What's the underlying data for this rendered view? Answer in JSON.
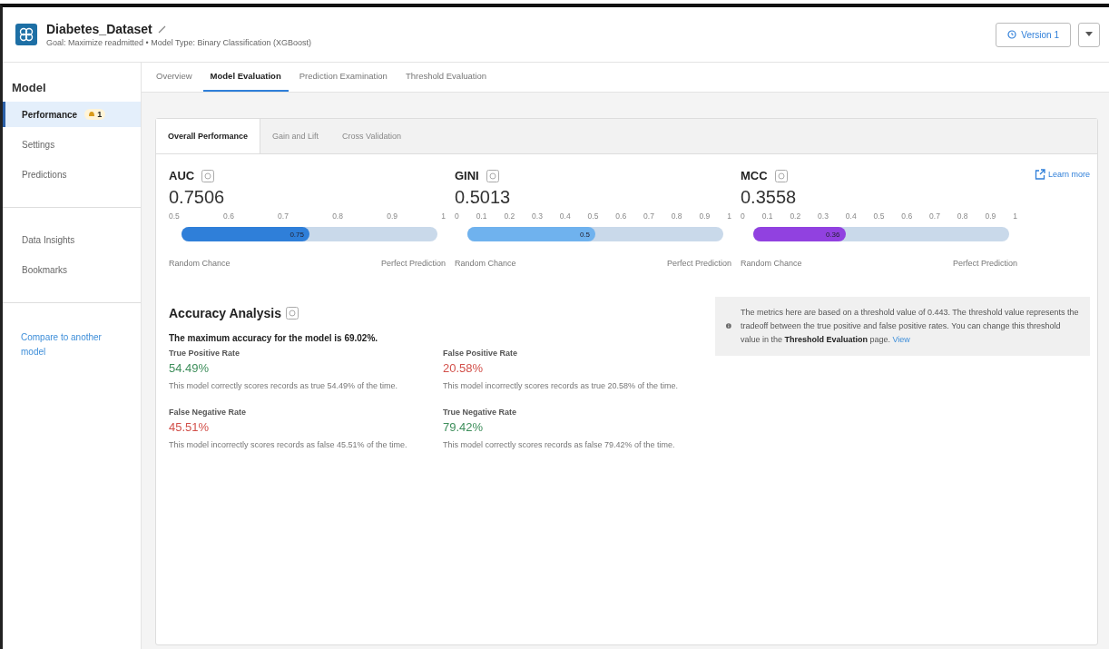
{
  "header": {
    "title": "Diabetes_Dataset",
    "subtitle": "Goal: Maximize readmitted • Model Type: Binary Classification (XGBoost)",
    "version_button": "Version 1"
  },
  "sidebar": {
    "heading": "Model",
    "groups": [
      [
        {
          "label": "Performance",
          "selected": true,
          "badge": "1"
        },
        {
          "label": "Settings",
          "selected": false
        },
        {
          "label": "Predictions",
          "selected": false
        }
      ],
      [
        {
          "label": "Data Insights",
          "selected": false
        },
        {
          "label": "Bookmarks",
          "selected": false
        }
      ]
    ],
    "link": "Compare to another model"
  },
  "tabs": [
    {
      "label": "Overview",
      "selected": false
    },
    {
      "label": "Model Evaluation",
      "selected": true
    },
    {
      "label": "Prediction Examination",
      "selected": false
    },
    {
      "label": "Threshold Evaluation",
      "selected": false
    }
  ],
  "subtabs": [
    {
      "label": "Overall Performance",
      "selected": true
    },
    {
      "label": "Gain and Lift",
      "selected": false
    },
    {
      "label": "Cross Validation",
      "selected": false
    }
  ],
  "learn_more": "Learn more",
  "metrics": [
    {
      "name": "AUC",
      "value": "0.7506",
      "ticks": [
        "0.5",
        "0.6",
        "0.7",
        "0.8",
        "0.9",
        "1"
      ],
      "level": 0.5,
      "fill_label": "0.75",
      "color": "#2f7fd9",
      "left_label": "Random Chance",
      "right_label": "Perfect Prediction"
    },
    {
      "name": "GINI",
      "value": "0.5013",
      "ticks": [
        "0",
        "0.1",
        "0.2",
        "0.3",
        "0.4",
        "0.5",
        "0.6",
        "0.7",
        "0.8",
        "0.9",
        "1"
      ],
      "level": 0.5,
      "fill_label": "0.5",
      "color": "#6fb2ee",
      "left_label": "Random Chance",
      "right_label": "Perfect Prediction"
    },
    {
      "name": "MCC",
      "value": "0.3558",
      "ticks": [
        "0",
        "0.1",
        "0.2",
        "0.3",
        "0.4",
        "0.5",
        "0.6",
        "0.7",
        "0.8",
        "0.9",
        "1"
      ],
      "level": 0.36,
      "fill_label": "0.36",
      "color": "#9141e0",
      "left_label": "Random Chance",
      "right_label": "Perfect Prediction"
    }
  ],
  "accuracy": {
    "title": "Accuracy Analysis",
    "summary": "The maximum accuracy for the model is 69.02%.",
    "rates": [
      {
        "label": "True Positive Rate",
        "value": "54.49%",
        "color": "#3f8f5c",
        "description": "This model correctly scores records as true 54.49% of the time."
      },
      {
        "label": "False Positive Rate",
        "value": "20.58%",
        "color": "#d2504a",
        "description": "This model incorrectly scores records as true 20.58% of the time."
      },
      {
        "label": "False Negative Rate",
        "value": "45.51%",
        "color": "#d2504a",
        "description": "This model incorrectly scores records as false 45.51% of the time."
      },
      {
        "label": "True Negative Rate",
        "value": "79.42%",
        "color": "#3f8f5c",
        "description": "This model correctly scores records as false 79.42% of the time."
      }
    ]
  },
  "info": {
    "text": "The metrics here are based on a threshold value of 0.443. The threshold value represents the tradeoff between the true positive and false positive rates. You can change this threshold value in the **Threshold Evaluation** page.",
    "link": "View"
  }
}
